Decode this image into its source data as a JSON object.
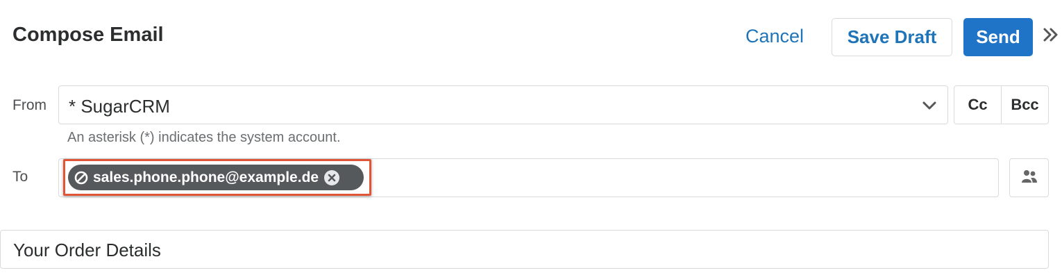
{
  "header": {
    "title": "Compose Email",
    "cancel_label": "Cancel",
    "save_draft_label": "Save Draft",
    "send_label": "Send",
    "expand_icon": "double-chevron-right-icon"
  },
  "from": {
    "label": "From",
    "value": "* SugarCRM",
    "dropdown_icon": "chevron-down-icon",
    "hint": "An asterisk (*) indicates the system account."
  },
  "copy_buttons": {
    "cc_label": "Cc",
    "bcc_label": "Bcc"
  },
  "to": {
    "label": "To",
    "recipients": [
      {
        "address": "sales.phone.phone@example.de",
        "status_icon": "ban-icon",
        "remove_icon": "close-circle-icon",
        "highlighted": true
      }
    ],
    "address_book_icon": "people-icon"
  },
  "subject": {
    "value": "Your Order Details"
  },
  "colors": {
    "accent": "#1f74c7",
    "link": "#1f74b8",
    "pill_bg": "#56595b",
    "highlight_border": "#e05438"
  }
}
